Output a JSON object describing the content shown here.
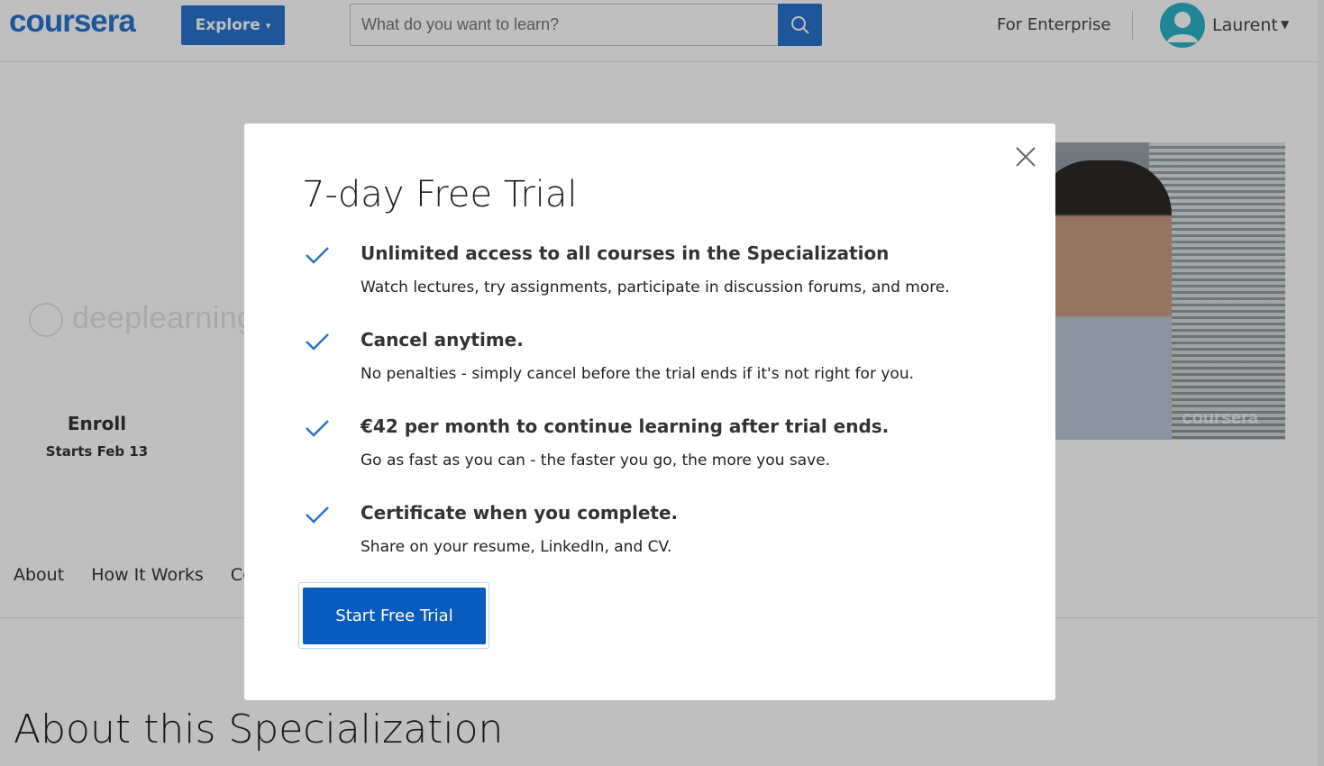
{
  "header": {
    "logo_text": "coursera",
    "explore_label": "Explore",
    "search_placeholder": "What do you want to learn?",
    "enterprise_label": "For Enterprise",
    "user_name": "Laurent"
  },
  "background": {
    "brand_watermark": "deeplearning",
    "enroll_label": "Enroll",
    "enroll_date": "Starts Feb 13",
    "video_watermark": "coursera",
    "tabs": [
      "About",
      "How It Works",
      "Co"
    ],
    "section_heading": "About this Specialization"
  },
  "modal": {
    "title": "7-day Free Trial",
    "features": [
      {
        "title": "Unlimited access to all courses in the Specialization",
        "desc": "Watch lectures, try assignments, participate in discussion forums, and more."
      },
      {
        "title": "Cancel anytime.",
        "desc": "No penalties - simply cancel before the trial ends if it's not right for you."
      },
      {
        "title": "€42 per month to continue learning after trial ends.",
        "desc": "Go as fast as you can - the faster you go, the more you save."
      },
      {
        "title": "Certificate when you complete.",
        "desc": "Share on your resume, LinkedIn, and CV."
      }
    ],
    "cta_label": "Start Free Trial"
  },
  "icons": {
    "check": "check-icon",
    "close": "close-icon",
    "search": "search-icon",
    "avatar": "user-avatar-icon"
  },
  "colors": {
    "brand_blue": "#2a73cc",
    "cta_blue": "#0a5bc0",
    "check_blue": "#2a73cc",
    "avatar_teal": "#2bb3c9"
  }
}
